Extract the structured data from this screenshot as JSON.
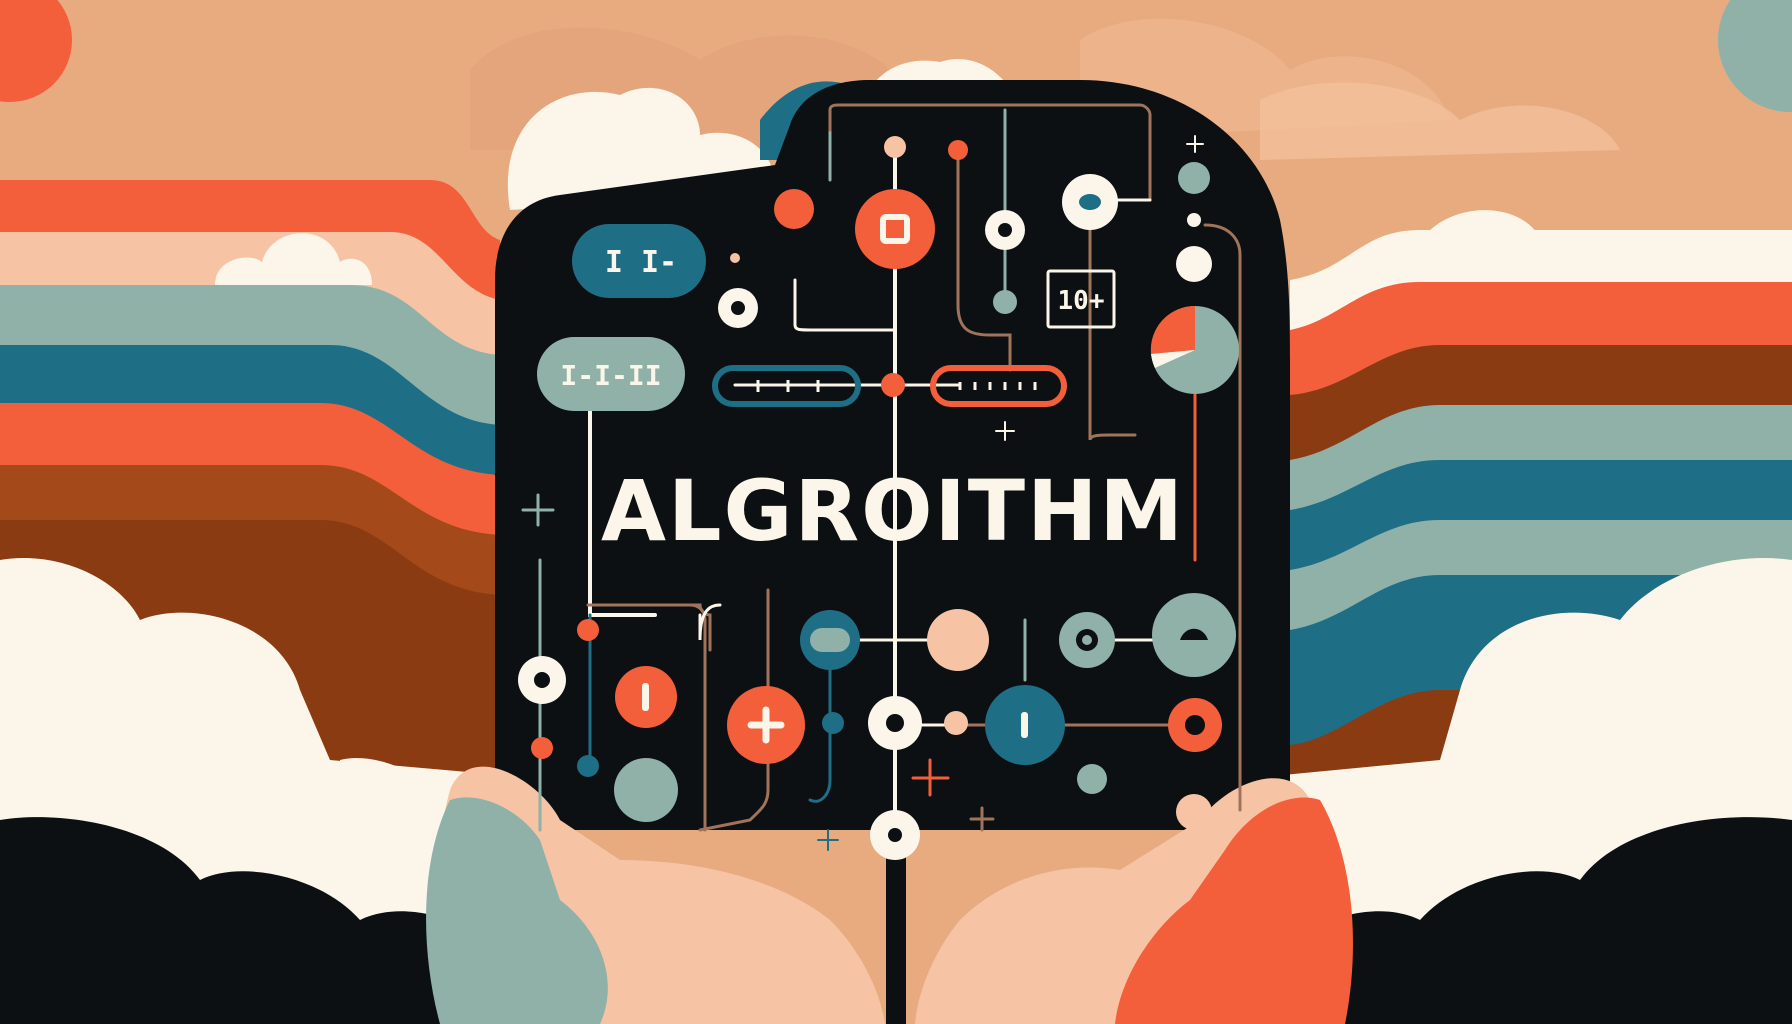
{
  "title": "ALGROITHM",
  "labels": {
    "pill_a": "I I-",
    "pill_b": "I-I-II",
    "box": "10+"
  },
  "colors": {
    "sky": "#e8ab80",
    "sky_light": "#f2c09a",
    "orange": "#f25f3a",
    "teal": "#1e6e86",
    "sage": "#8fb1a8",
    "rust": "#8a3b12",
    "brown": "#a4491a",
    "cream": "#fbf5ea",
    "peach": "#f6c4a4",
    "dark": "#0c1012"
  }
}
